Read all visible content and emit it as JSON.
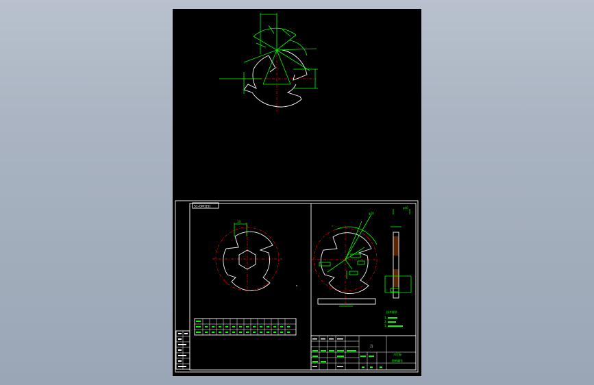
{
  "drawing": {
    "section_label": "S1-GM1[S]",
    "title_block": {
      "part_name": "刀",
      "name_cell_1": "刀片板",
      "name_cell_2": "图纸编号"
    },
    "tech_requirements": {
      "heading": "技术要求",
      "items": [
        "1.",
        "2.",
        "3."
      ]
    }
  },
  "colors": {
    "background": "#000000",
    "geometry": "#ffffff",
    "dimension": "#00ff00",
    "centerline": "#ff0000",
    "viewport": "#a9b3c1"
  }
}
